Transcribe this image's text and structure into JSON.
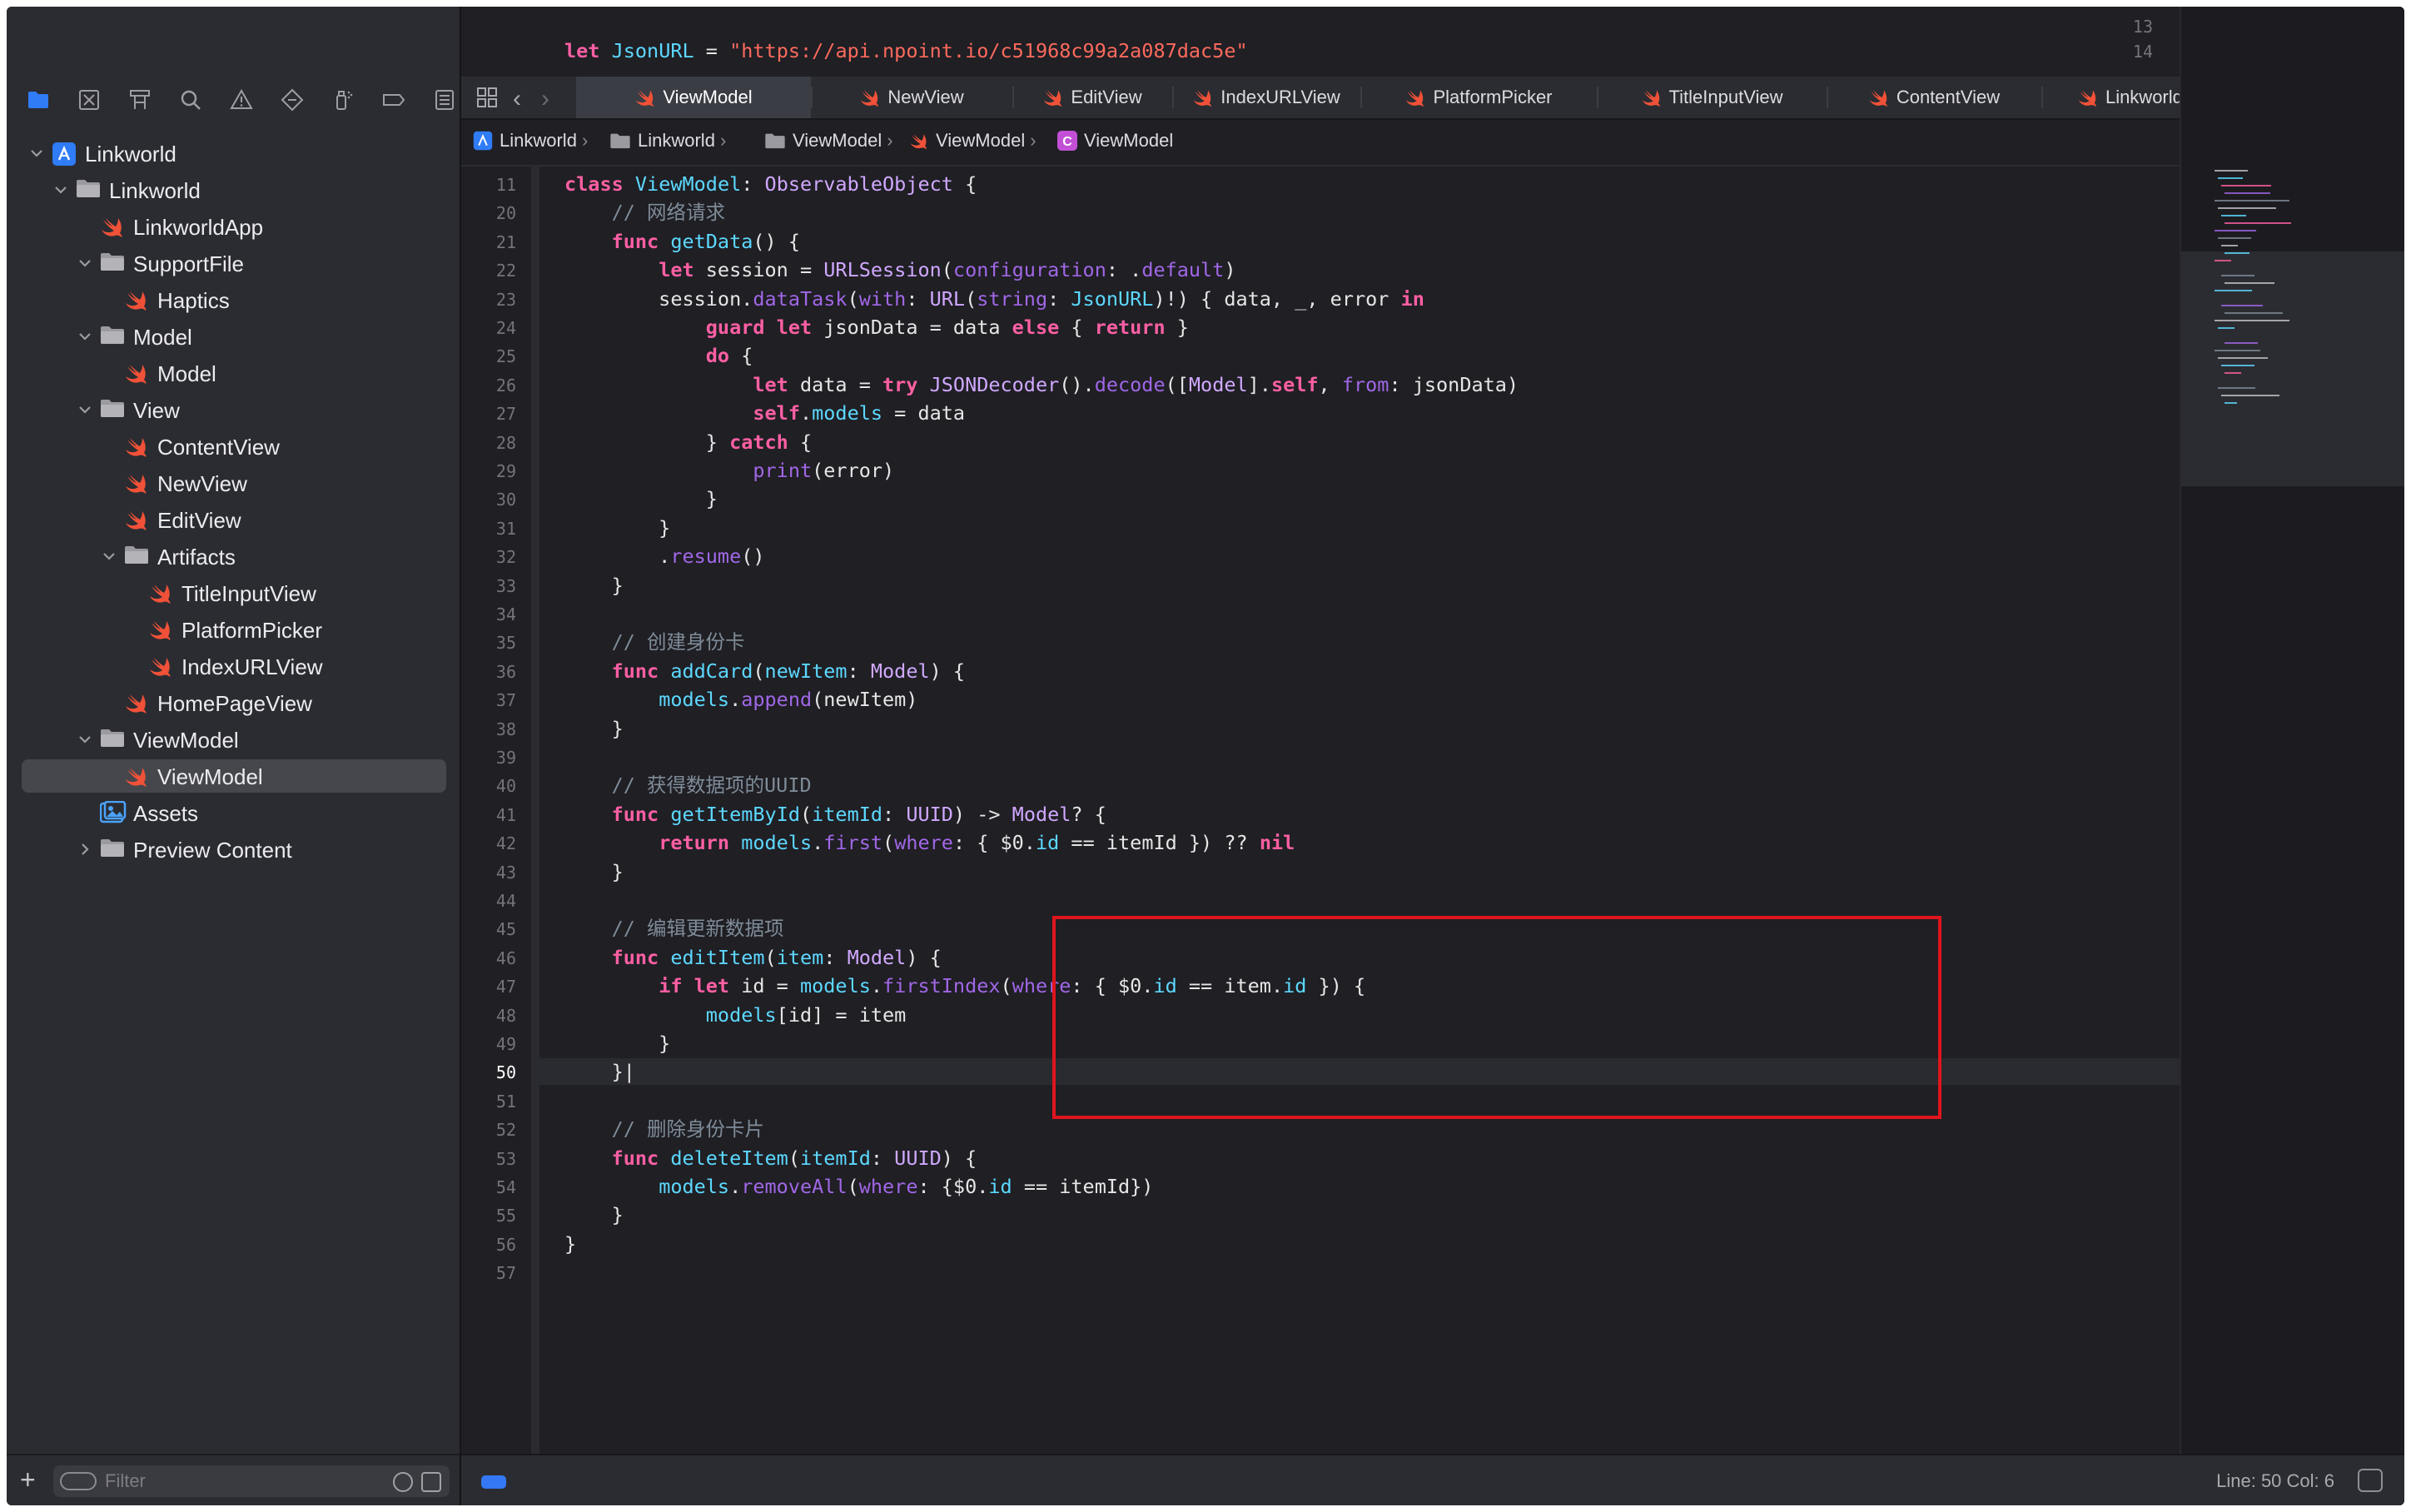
{
  "sidebar": {
    "toolbar_icons": [
      "folder-icon",
      "source-control-icon",
      "symbol-navigator-icon",
      "search-icon",
      "issue-warning-icon",
      "test-diamond-icon",
      "debug-spray-icon",
      "breakpoint-icon",
      "report-icon"
    ],
    "tree": [
      {
        "label": "Linkworld",
        "icon": "project-icon",
        "level": 0,
        "expanded": true
      },
      {
        "label": "Linkworld",
        "icon": "folder-icon",
        "level": 1,
        "expanded": true
      },
      {
        "label": "LinkworldApp",
        "icon": "swift-icon",
        "level": 2
      },
      {
        "label": "SupportFile",
        "icon": "folder-icon",
        "level": 2,
        "expanded": true
      },
      {
        "label": "Haptics",
        "icon": "swift-icon",
        "level": 3
      },
      {
        "label": "Model",
        "icon": "folder-icon",
        "level": 2,
        "expanded": true
      },
      {
        "label": "Model",
        "icon": "swift-icon",
        "level": 3
      },
      {
        "label": "View",
        "icon": "folder-icon",
        "level": 2,
        "expanded": true
      },
      {
        "label": "ContentView",
        "icon": "swift-icon",
        "level": 3
      },
      {
        "label": "NewView",
        "icon": "swift-icon",
        "level": 3
      },
      {
        "label": "EditView",
        "icon": "swift-icon",
        "level": 3
      },
      {
        "label": "Artifacts",
        "icon": "folder-icon",
        "level": 3,
        "expanded": true
      },
      {
        "label": "TitleInputView",
        "icon": "swift-icon",
        "level": 4
      },
      {
        "label": "PlatformPicker",
        "icon": "swift-icon",
        "level": 4
      },
      {
        "label": "IndexURLView",
        "icon": "swift-icon",
        "level": 4
      },
      {
        "label": "HomePageView",
        "icon": "swift-icon",
        "level": 3
      },
      {
        "label": "ViewModel",
        "icon": "folder-icon",
        "level": 2,
        "expanded": true
      },
      {
        "label": "ViewModel",
        "icon": "swift-icon",
        "level": 3,
        "selected": true
      },
      {
        "label": "Assets",
        "icon": "assets-icon",
        "level": 2
      },
      {
        "label": "Preview Content",
        "icon": "folder-icon",
        "level": 2,
        "expanded": false
      }
    ],
    "filter_placeholder": "Filter"
  },
  "editor": {
    "peek_lines": [
      {
        "num": "13",
        "code": ""
      },
      {
        "num": "14",
        "code": "<span class=\"k\">let</span> <span class=\"t\">JsonURL</span> = <span class=\"s\">\"https://api.npoint.io/c51968c99a2a087dac5e\"</span>"
      }
    ],
    "tabs": [
      {
        "label": "ViewModel",
        "active": true
      },
      {
        "label": "NewView"
      },
      {
        "label": "EditView"
      },
      {
        "label": "IndexURLView"
      },
      {
        "label": "PlatformPicker"
      },
      {
        "label": "TitleInputView"
      },
      {
        "label": "ContentView"
      },
      {
        "label": "LinkworldApp"
      }
    ],
    "breadcrumb": [
      "Linkworld",
      "Linkworld",
      "ViewModel",
      "ViewModel",
      "ViewModel"
    ],
    "current_line": "50",
    "lines": [
      {
        "num": "11",
        "code": "<span class=\"k\">class</span> <span class=\"t\">ViewModel</span>: <span class=\"tt\">ObservableObject</span> {"
      },
      {
        "num": "20",
        "code": "    <span class=\"c\">// 网络请求</span>"
      },
      {
        "num": "21",
        "code": "    <span class=\"k\">func</span> <span class=\"t\">getData</span>() {"
      },
      {
        "num": "22",
        "code": "        <span class=\"k\">let</span> session = <span class=\"tt\">URLSession</span>(<span class=\"m\">configuration</span>: .<span class=\"m\">default</span>)"
      },
      {
        "num": "23",
        "code": "        session.<span class=\"m\">dataTask</span>(<span class=\"m\">with</span>: <span class=\"tt\">URL</span>(<span class=\"m\">string</span>: <span class=\"t\">JsonURL</span>)!) { data, _, error <span class=\"k\">in</span>"
      },
      {
        "num": "24",
        "code": "            <span class=\"k\">guard</span> <span class=\"k\">let</span> jsonData = data <span class=\"k\">else</span> { <span class=\"k\">return</span> }"
      },
      {
        "num": "25",
        "code": "            <span class=\"k\">do</span> {"
      },
      {
        "num": "26",
        "code": "                <span class=\"k\">let</span> data = <span class=\"k\">try</span> <span class=\"tt\">JSONDecoder</span>().<span class=\"m\">decode</span>([<span class=\"tt\">Model</span>].<span class=\"k\">self</span>, <span class=\"m\">from</span>: jsonData)"
      },
      {
        "num": "27",
        "code": "                <span class=\"k\">self</span>.<span class=\"t\">models</span> = data"
      },
      {
        "num": "28",
        "code": "            } <span class=\"k\">catch</span> {"
      },
      {
        "num": "29",
        "code": "                <span class=\"m\">print</span>(error)"
      },
      {
        "num": "30",
        "code": "            }"
      },
      {
        "num": "31",
        "code": "        }"
      },
      {
        "num": "32",
        "code": "        .<span class=\"m\">resume</span>()"
      },
      {
        "num": "33",
        "code": "    }"
      },
      {
        "num": "34",
        "code": ""
      },
      {
        "num": "35",
        "code": "    <span class=\"c\">// 创建身份卡</span>"
      },
      {
        "num": "36",
        "code": "    <span class=\"k\">func</span> <span class=\"t\">addCard</span>(<span class=\"t\">newItem</span>: <span class=\"tt\">Model</span>) {"
      },
      {
        "num": "37",
        "code": "        <span class=\"t\">models</span>.<span class=\"m\">append</span>(newItem)"
      },
      {
        "num": "38",
        "code": "    }"
      },
      {
        "num": "39",
        "code": ""
      },
      {
        "num": "40",
        "code": "    <span class=\"c\">// 获得数据项的UUID</span>"
      },
      {
        "num": "41",
        "code": "    <span class=\"k\">func</span> <span class=\"t\">getItemById</span>(<span class=\"t\">itemId</span>: <span class=\"tt\">UUID</span>) -> <span class=\"tt\">Model</span>? {"
      },
      {
        "num": "42",
        "code": "        <span class=\"k\">return</span> <span class=\"t\">models</span>.<span class=\"m\">first</span>(<span class=\"m\">where</span>: { $0.<span class=\"t\">id</span> == itemId }) ?? <span class=\"k\">nil</span>"
      },
      {
        "num": "43",
        "code": "    }"
      },
      {
        "num": "44",
        "code": ""
      },
      {
        "num": "45",
        "code": "    <span class=\"c\">// 编辑更新数据项</span>"
      },
      {
        "num": "46",
        "code": "    <span class=\"k\">func</span> <span class=\"t\">editItem</span>(<span class=\"t\">item</span>: <span class=\"tt\">Model</span>) {"
      },
      {
        "num": "47",
        "code": "        <span class=\"k\">if</span> <span class=\"k\">let</span> id = <span class=\"t\">models</span>.<span class=\"m\">firstIndex</span>(<span class=\"m\">where</span>: { $0.<span class=\"t\">id</span> == item.<span class=\"t\">id</span> }) {"
      },
      {
        "num": "48",
        "code": "            <span class=\"t\">models</span>[id] = item"
      },
      {
        "num": "49",
        "code": "        }"
      },
      {
        "num": "50",
        "code": "    }|"
      },
      {
        "num": "51",
        "code": ""
      },
      {
        "num": "52",
        "code": "    <span class=\"c\">// 删除身份卡片</span>"
      },
      {
        "num": "53",
        "code": "    <span class=\"k\">func</span> <span class=\"t\">deleteItem</span>(<span class=\"t\">itemId</span>: <span class=\"tt\">UUID</span>) {"
      },
      {
        "num": "54",
        "code": "        <span class=\"t\">models</span>.<span class=\"m\">removeAll</span>(<span class=\"m\">where</span>: {$0.<span class=\"t\">id</span> == itemId})"
      },
      {
        "num": "55",
        "code": "    }"
      },
      {
        "num": "56",
        "code": "}"
      },
      {
        "num": "57",
        "code": ""
      }
    ],
    "status": "Line: 50  Col: 6"
  },
  "colors": {
    "keyword": "#fc5fa3",
    "type": "#5dd8ff",
    "string": "#fc6a5d",
    "comment": "#7f8c98",
    "method": "#a167e6",
    "highlight_box": "#e0141d",
    "swift": "#f05138",
    "folder": "#9a9aa0"
  }
}
